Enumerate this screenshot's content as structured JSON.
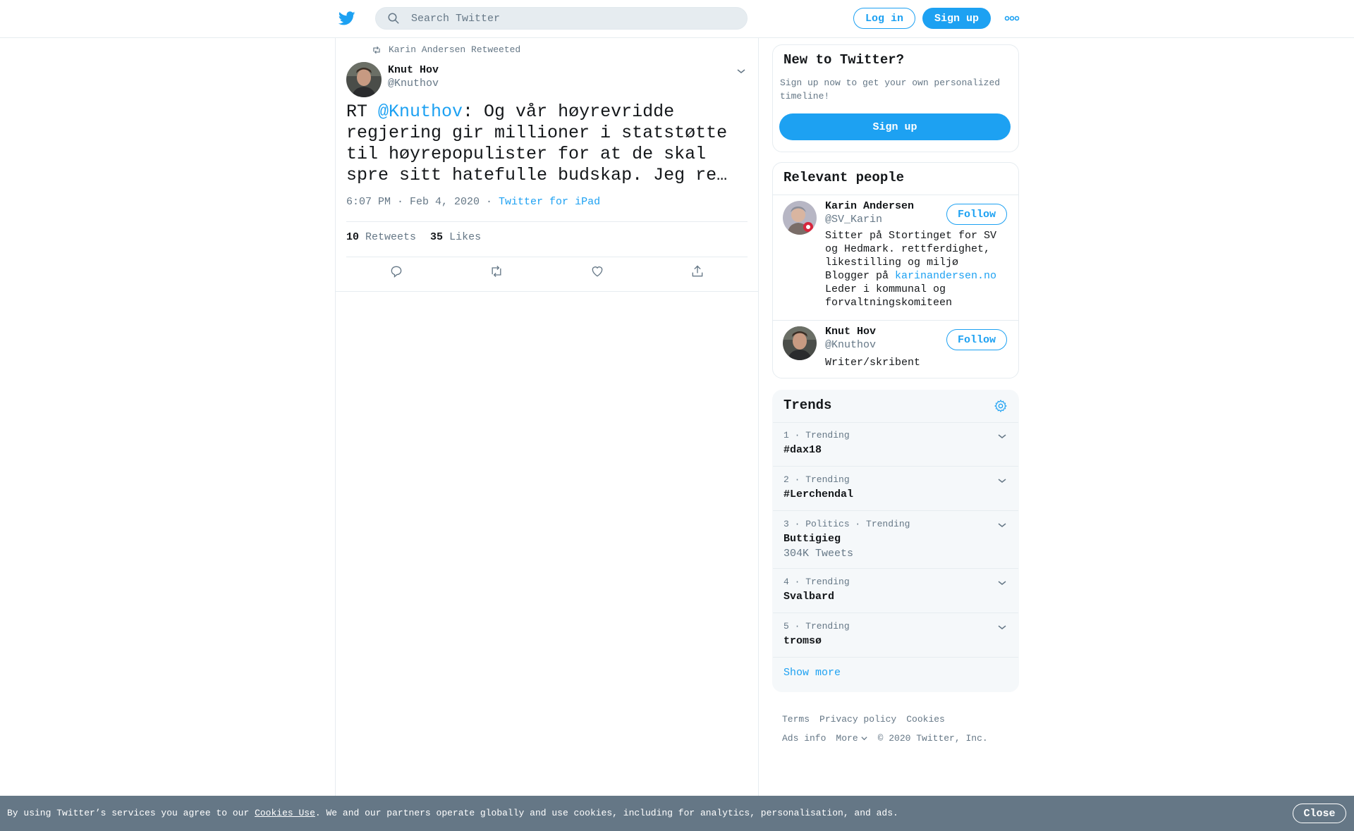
{
  "header": {
    "logo_icon": "twitter-bird-icon",
    "search_placeholder": "Search Twitter",
    "login_label": "Log in",
    "signup_label": "Sign up",
    "more_icon": "more-dots-icon"
  },
  "tweet": {
    "retweeted_by": "Karin Andersen Retweeted",
    "author_name": "Knut Hov",
    "author_handle": "@Knuthov",
    "text_prefix": "RT ",
    "mention": "@Knuthov",
    "text_body": ": Og vår høyrevridde regjering gir millioner i statstøtte til høyrepopulister for at de skal spre sitt hatefulle budskap. Jeg re…",
    "time": "6:07 PM · Feb 4, 2020",
    "separator": " · ",
    "source": "Twitter for iPad",
    "retweets_count": "10",
    "retweets_label": "Retweets",
    "likes_count": "35",
    "likes_label": "Likes",
    "action_icons": [
      "reply-icon",
      "retweet-icon",
      "like-icon",
      "share-icon"
    ]
  },
  "new_to_twitter": {
    "title": "New to Twitter?",
    "description": "Sign up now to get your own personalized timeline!",
    "button": "Sign up"
  },
  "relevant_people": {
    "title": "Relevant people",
    "people": [
      {
        "name": "Karin Andersen",
        "handle": "@SV_Karin",
        "follow": "Follow",
        "bio_1": "Sitter på Stortinget for SV og Hedmark. rettferdighet, likestilling og miljø",
        "bio_2_prefix": "Blogger på ",
        "bio_2_link": "karinandersen.no",
        "bio_3": "Leder i kommunal og forvaltningskomiteen"
      },
      {
        "name": "Knut Hov",
        "handle": "@Knuthov",
        "follow": "Follow",
        "bio_1": "Writer/skribent"
      }
    ]
  },
  "trends": {
    "title": "Trends",
    "items": [
      {
        "meta": "1 · Trending",
        "name": "#dax18"
      },
      {
        "meta": "2 · Trending",
        "name": "#Lerchendal"
      },
      {
        "meta": "3 · Politics · Trending",
        "name": "Buttigieg",
        "count": "304K Tweets"
      },
      {
        "meta": "4 · Trending",
        "name": "Svalbard"
      },
      {
        "meta": "5 · Trending",
        "name": "tromsø"
      }
    ],
    "show_more": "Show more"
  },
  "footer": {
    "terms": "Terms",
    "privacy": "Privacy policy",
    "cookies": "Cookies",
    "ads_info": "Ads info",
    "more": "More",
    "copyright": "© 2020 Twitter, Inc."
  },
  "cookie_bar": {
    "text_before": "By using Twitter’s services you agree to our ",
    "link": "Cookies Use",
    "text_after": ". We and our partners operate globally and use cookies, including for analytics, personalisation, and ads.",
    "close": "Close"
  },
  "colors": {
    "brand": "#1da1f2",
    "text": "#14171a",
    "secondary": "#657786",
    "cookie_bar": "#657786"
  }
}
